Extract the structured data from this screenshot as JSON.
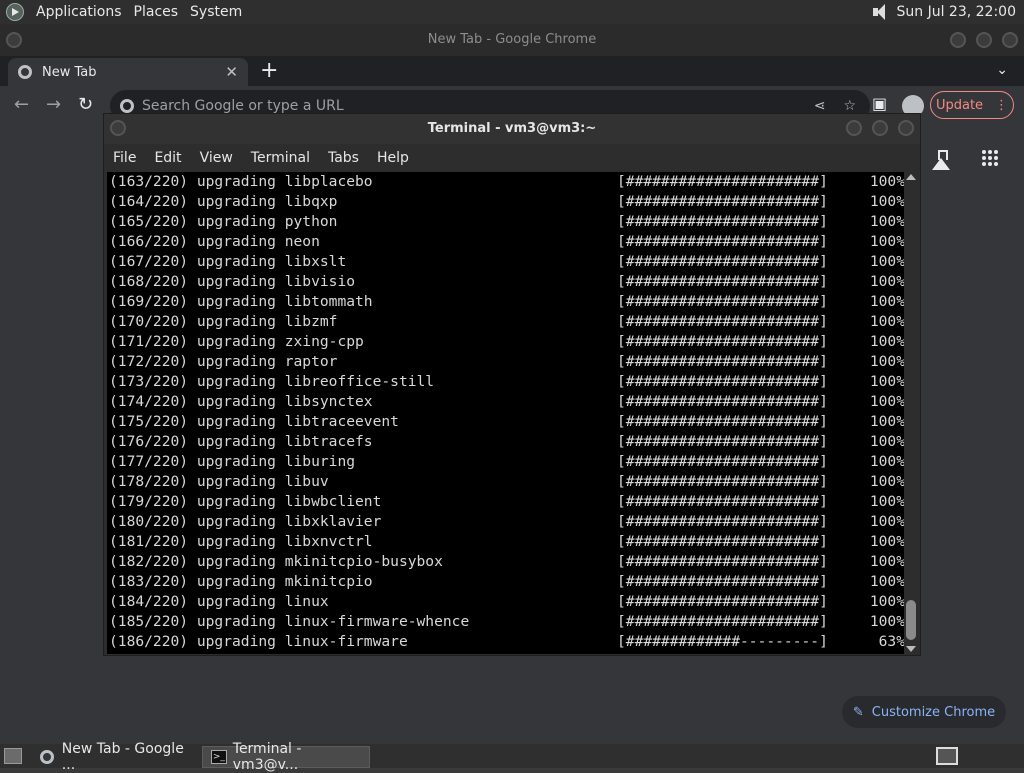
{
  "top_panel": {
    "menus": [
      "Applications",
      "Places",
      "System"
    ],
    "clock": "Sun Jul 23, 22:00"
  },
  "chrome": {
    "window_title": "New Tab - Google Chrome",
    "tab_label": "New Tab",
    "tab_close": "✕",
    "new_tab": "+",
    "omnibox_placeholder": "Search Google or type a URL",
    "update_label": "Update",
    "customize_label": "Customize Chrome",
    "accent_color": "#8ab4f8",
    "update_color": "#f28b82"
  },
  "terminal": {
    "title": "Terminal - vm3@vm3:~",
    "menu": [
      "File",
      "Edit",
      "View",
      "Terminal",
      "Tabs",
      "Help"
    ],
    "lines": [
      {
        "text": "(163/220) upgrading libplacebo",
        "bar": "[######################]",
        "pct": "100%"
      },
      {
        "text": "(164/220) upgrading libqxp",
        "bar": "[######################]",
        "pct": "100%"
      },
      {
        "text": "(165/220) upgrading python",
        "bar": "[######################]",
        "pct": "100%"
      },
      {
        "text": "(166/220) upgrading neon",
        "bar": "[######################]",
        "pct": "100%"
      },
      {
        "text": "(167/220) upgrading libxslt",
        "bar": "[######################]",
        "pct": "100%"
      },
      {
        "text": "(168/220) upgrading libvisio",
        "bar": "[######################]",
        "pct": "100%"
      },
      {
        "text": "(169/220) upgrading libtommath",
        "bar": "[######################]",
        "pct": "100%"
      },
      {
        "text": "(170/220) upgrading libzmf",
        "bar": "[######################]",
        "pct": "100%"
      },
      {
        "text": "(171/220) upgrading zxing-cpp",
        "bar": "[######################]",
        "pct": "100%"
      },
      {
        "text": "(172/220) upgrading raptor",
        "bar": "[######################]",
        "pct": "100%"
      },
      {
        "text": "(173/220) upgrading libreoffice-still",
        "bar": "[######################]",
        "pct": "100%"
      },
      {
        "text": "(174/220) upgrading libsynctex",
        "bar": "[######################]",
        "pct": "100%"
      },
      {
        "text": "(175/220) upgrading libtraceevent",
        "bar": "[######################]",
        "pct": "100%"
      },
      {
        "text": "(176/220) upgrading libtracefs",
        "bar": "[######################]",
        "pct": "100%"
      },
      {
        "text": "(177/220) upgrading liburing",
        "bar": "[######################]",
        "pct": "100%"
      },
      {
        "text": "(178/220) upgrading libuv",
        "bar": "[######################]",
        "pct": "100%"
      },
      {
        "text": "(179/220) upgrading libwbclient",
        "bar": "[######################]",
        "pct": "100%"
      },
      {
        "text": "(180/220) upgrading libxklavier",
        "bar": "[######################]",
        "pct": "100%"
      },
      {
        "text": "(181/220) upgrading libxnvctrl",
        "bar": "[######################]",
        "pct": "100%"
      },
      {
        "text": "(182/220) upgrading mkinitcpio-busybox",
        "bar": "[######################]",
        "pct": "100%"
      },
      {
        "text": "(183/220) upgrading mkinitcpio",
        "bar": "[######################]",
        "pct": "100%"
      },
      {
        "text": "(184/220) upgrading linux",
        "bar": "[######################]",
        "pct": "100%"
      },
      {
        "text": "(185/220) upgrading linux-firmware-whence",
        "bar": "[######################]",
        "pct": "100%"
      },
      {
        "text": "(186/220) upgrading linux-firmware",
        "bar": "[#############---------]",
        "pct": "63%"
      }
    ]
  },
  "taskbar": {
    "tasks": [
      {
        "label": "New Tab - Google ..."
      },
      {
        "label": "Terminal - vm3@v..."
      }
    ]
  }
}
